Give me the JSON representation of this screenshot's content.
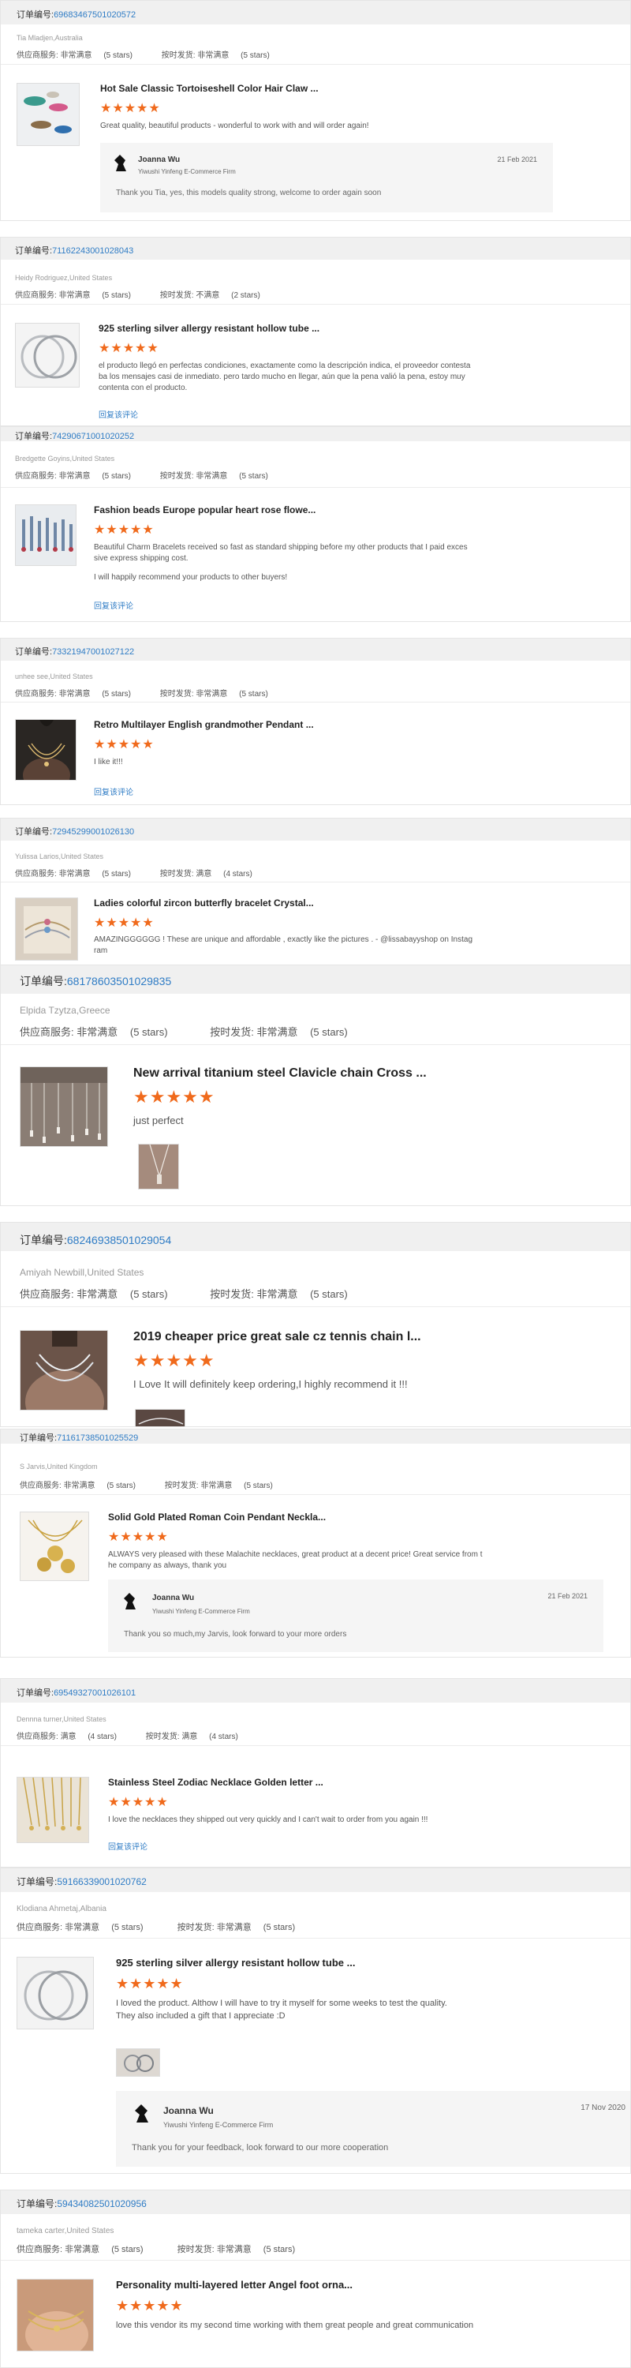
{
  "labels": {
    "order_prefix": "订单编号:",
    "supplier_service": "供应商服务:",
    "shipping_speed": "按时发货:",
    "reply_link": "回复该评论"
  },
  "colors": {
    "star": "#f06a1c",
    "link": "#2f7cc5",
    "header_bg": "#f0f0f0"
  },
  "reviews": [
    {
      "order_no": "69683467501020572",
      "buyer": "Tia Mladjen,Australia",
      "service": "非常满意",
      "service_stars": "(5 stars)",
      "shipping": "非常满意",
      "shipping_stars": "(5 stars)",
      "product": "Hot Sale Classic Tortoiseshell Color Hair Claw ...",
      "stars": "★★★★★",
      "text": "Great quality, beautiful products - wonderful to work with and will order again!",
      "reply": {
        "name": "Joanna Wu",
        "firm": "Yiwushi Yinfeng E-Commerce Firm",
        "date": "21 Feb 2021",
        "text": "Thank you Tia, yes, this models quality strong, welcome to order again soon"
      }
    },
    {
      "order_no": "71162243001028043",
      "buyer": "Heidy Rodriguez,United States",
      "service": "非常满意",
      "service_stars": "(5 stars)",
      "shipping": "不满意",
      "shipping_stars": "(2 stars)",
      "product": "925 sterling silver allergy resistant hollow tube ...",
      "stars": "★★★★★",
      "text1": "el producto llegó en perfectas condiciones, exactamente como la descripción indica, el proveedor contesta",
      "text2": "ba los mensajes casi de inmediato. pero tardo mucho en llegar, aún que la pena valió la pena, estoy muy",
      "text3": "contenta con el producto.",
      "reply_link": "回复该评论"
    },
    {
      "order_no": "74290671001020252",
      "buyer": "Bredgette Goyins,United States",
      "service": "非常满意",
      "service_stars": "(5 stars)",
      "shipping": "非常满意",
      "shipping_stars": "(5 stars)",
      "product": "Fashion beads Europe popular heart rose flowe...",
      "stars": "★★★★★",
      "text1": "Beautiful Charm Bracelets received so fast as standard shipping before my other products that I paid exces",
      "text2": "sive express shipping cost.",
      "text3": "I will happily recommend your products to other buyers!",
      "reply_link": "回复该评论"
    },
    {
      "order_no": "73321947001027122",
      "buyer": "unhee see,United States",
      "service": "非常满意",
      "service_stars": "(5 stars)",
      "shipping": "非常满意",
      "shipping_stars": "(5 stars)",
      "product": "Retro Multilayer English grandmother Pendant ...",
      "stars": "★★★★★",
      "text": "I like it!!!",
      "reply_link": "回复该评论"
    },
    {
      "order_no": "72945299001026130",
      "buyer": "Yulissa Larios,United States",
      "service": "非常满意",
      "service_stars": "(5 stars)",
      "shipping": "满意",
      "shipping_stars": "(4 stars)",
      "product": "Ladies colorful zircon butterfly bracelet Crystal...",
      "stars": "★★★★★",
      "text1": "AMAZINGGGGGG ! These are unique and affordable , exactly like the pictures . - @lissabayyshop on Instag",
      "text2": "ram"
    },
    {
      "order_no": "68178603501029835",
      "buyer": "Elpida Tzytza,Greece",
      "service": "非常满意",
      "service_stars": "(5 stars)",
      "shipping": "非常满意",
      "shipping_stars": "(5 stars)",
      "product": "New arrival titanium steel Clavicle chain Cross ...",
      "stars": "★★★★★",
      "text": "just perfect"
    },
    {
      "order_no": "68246938501029054",
      "buyer": "Amiyah Newbill,United States",
      "service": "非常满意",
      "service_stars": "(5 stars)",
      "shipping": "非常满意",
      "shipping_stars": "(5 stars)",
      "product": "2019 cheaper price great sale cz tennis chain l...",
      "stars": "★★★★★",
      "text": "I Love It will definitely keep ordering,I highly recommend it !!!"
    },
    {
      "order_no": "71161738501025529",
      "buyer": "S Jarvis,United Kingdom",
      "service": "非常满意",
      "service_stars": "(5 stars)",
      "shipping": "非常满意",
      "shipping_stars": "(5 stars)",
      "product": "Solid Gold Plated Roman Coin Pendant Neckla...",
      "stars": "★★★★★",
      "text1": "ALWAYS very pleased with these Malachite necklaces, great product at a decent price! Great service from t",
      "text2": "he company as always, thank you",
      "reply": {
        "name": "Joanna Wu",
        "firm": "Yiwushi Yinfeng E-Commerce Firm",
        "date": "21 Feb 2021",
        "text": "Thank you so much,my Jarvis, look forward to your more orders"
      }
    },
    {
      "order_no": "69549327001026101",
      "buyer": "Dennna turner,United States",
      "service": "满意",
      "service_stars": "(4 stars)",
      "shipping": "满意",
      "shipping_stars": "(4 stars)",
      "product": "Stainless Steel Zodiac Necklace Golden letter ...",
      "stars": "★★★★★",
      "text": "I love the necklaces they shipped out very quickly and I can't wait to order from you again !!!",
      "reply_link": "回复该评论"
    },
    {
      "order_no": "59166339001020762",
      "buyer": "Klodiana Ahmetaj,Albania",
      "service": "非常满意",
      "service_stars": "(5 stars)",
      "shipping": "非常满意",
      "shipping_stars": "(5 stars)",
      "product": "925 sterling silver allergy resistant hollow tube ...",
      "stars": "★★★★★",
      "text1": "I loved the product. Althow I will have to try it myself for some weeks to test the quality.",
      "text2": "They also included a gift that I appreciate :D",
      "reply": {
        "name": "Joanna Wu",
        "firm": "Yiwushi Yinfeng E-Commerce Firm",
        "date": "17 Nov 2020",
        "text": "Thank you for your feedback, look forward to our more cooperation"
      }
    },
    {
      "order_no": "59434082501020956",
      "buyer": "tameka carter,United States",
      "service": "非常满意",
      "service_stars": "(5 stars)",
      "shipping": "非常满意",
      "shipping_stars": "(5 stars)",
      "product": "Personality multi-layered letter Angel foot orna...",
      "stars": "★★★★★",
      "text": "love this vendor its my second time working with them great people and great communication"
    }
  ]
}
